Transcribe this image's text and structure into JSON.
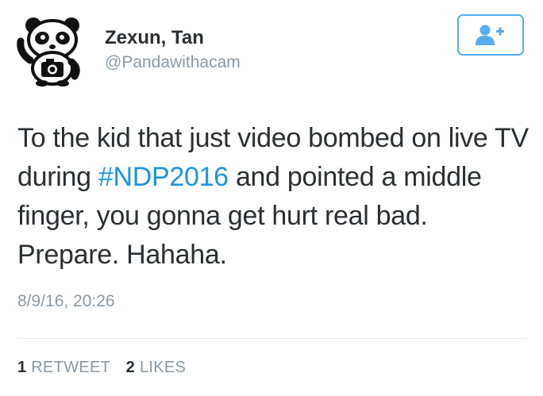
{
  "user": {
    "display_name": "Zexun, Tan",
    "handle": "@Pandawithacam"
  },
  "follow_button": {
    "icon": "add-user-icon"
  },
  "tweet": {
    "text_before": "To the kid that just video bombed on live TV during ",
    "hashtag": "#NDP2016",
    "text_after": " and pointed a middle finger, you gonna get hurt real bad. Prepare. Hahaha.",
    "timestamp": "8/9/16, 20:26"
  },
  "stats": {
    "retweet_count": "1",
    "retweet_label": "RETWEET",
    "like_count": "2",
    "like_label": "LIKES"
  },
  "colors": {
    "accent": "#55acee",
    "hashtag": "#1b95e0",
    "muted": "#8899a6",
    "text": "#292f33"
  }
}
